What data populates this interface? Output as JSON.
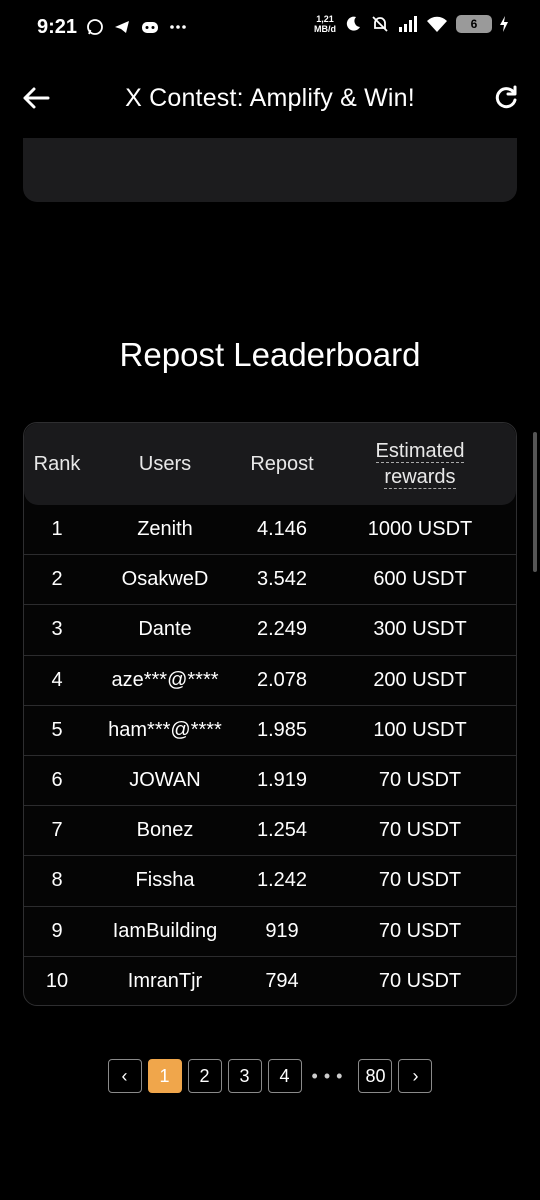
{
  "status_bar": {
    "time": "9:21",
    "net_speed_value": "1,21",
    "net_speed_unit": "MB/d",
    "battery": "6",
    "icons": [
      "whatsapp-icon",
      "telegram-icon",
      "discord-icon",
      "more-dots-icon",
      "moon-icon",
      "silent-icon",
      "signal-icon",
      "wifi-icon",
      "charging-icon"
    ]
  },
  "header": {
    "title": "X Contest: Amplify & Win!"
  },
  "section_title": "Repost Leaderboard",
  "table": {
    "columns": {
      "rank": "Rank",
      "users": "Users",
      "repost": "Repost",
      "reward_line1": "Estimated",
      "reward_line2": "rewards"
    },
    "rows": [
      {
        "rank": "1",
        "user": "Zenith",
        "repost": "4.146",
        "reward": "1000 USDT"
      },
      {
        "rank": "2",
        "user": "OsakweD",
        "repost": "3.542",
        "reward": "600 USDT"
      },
      {
        "rank": "3",
        "user": "Dante",
        "repost": "2.249",
        "reward": "300 USDT"
      },
      {
        "rank": "4",
        "user": "aze***@****",
        "repost": "2.078",
        "reward": "200 USDT"
      },
      {
        "rank": "5",
        "user": "ham***@****",
        "repost": "1.985",
        "reward": "100 USDT"
      },
      {
        "rank": "6",
        "user": "JOWAN",
        "repost": "1.919",
        "reward": "70 USDT"
      },
      {
        "rank": "7",
        "user": "Bonez",
        "repost": "1.254",
        "reward": "70 USDT"
      },
      {
        "rank": "8",
        "user": "Fissha",
        "repost": "1.242",
        "reward": "70 USDT"
      },
      {
        "rank": "9",
        "user": "IamBuilding",
        "repost": "919",
        "reward": "70 USDT"
      },
      {
        "rank": "10",
        "user": "ImranTjr",
        "repost": "794",
        "reward": "70 USDT"
      }
    ]
  },
  "pagination": {
    "prev": "‹",
    "pages": [
      "1",
      "2",
      "3",
      "4"
    ],
    "dots": "•••",
    "last": "80",
    "next": "›",
    "active": "1"
  },
  "colors": {
    "accent": "#f0a64b",
    "background": "#000000",
    "card": "#1c1c1e"
  }
}
